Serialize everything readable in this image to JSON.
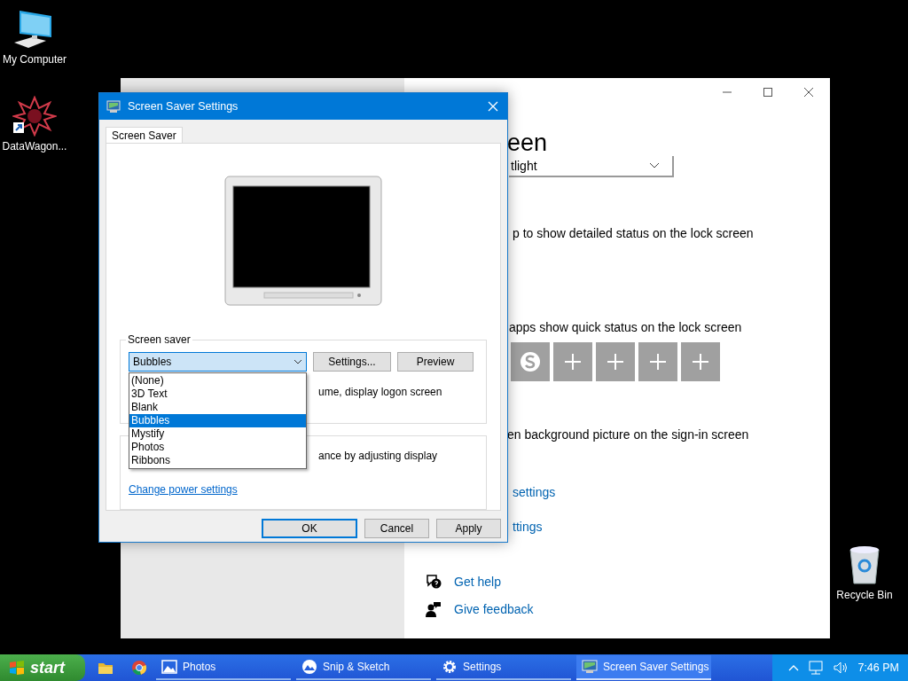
{
  "desktop_icons": [
    {
      "kind": "computer",
      "label": "My Computer"
    },
    {
      "kind": "shortcut",
      "label": "DataWagon..."
    },
    {
      "kind": "recycle",
      "label": "Recycle Bin"
    }
  ],
  "settings_window": {
    "rows": [
      {
        "kind": "heading",
        "text": "een"
      },
      {
        "kind": "dropdown",
        "value": "tlight"
      },
      {
        "kind": "text",
        "text": "p to show detailed status on the lock screen"
      },
      {
        "kind": "text",
        "text": "apps show quick status on the lock screen"
      },
      {
        "kind": "tiles",
        "tiles": [
          {
            "kind": "skype"
          },
          {
            "kind": "add"
          },
          {
            "kind": "add"
          },
          {
            "kind": "add"
          },
          {
            "kind": "add"
          }
        ]
      },
      {
        "kind": "text",
        "text": "en background picture on the sign-in screen"
      },
      {
        "kind": "link",
        "text": "settings"
      },
      {
        "kind": "link",
        "text": "ttings"
      },
      {
        "kind": "help",
        "text": "Get help"
      },
      {
        "kind": "feedback",
        "text": "Give feedback"
      }
    ]
  },
  "dialog": {
    "title": "Screen Saver Settings",
    "tabs": [
      {
        "label": "Screen Saver",
        "selected": true
      }
    ],
    "screen_saver_group": {
      "label": "Screen saver",
      "value": "Bubbles",
      "buttons": [
        "Settings...",
        "Preview"
      ],
      "resume_text": "ume, display logon screen",
      "options": [
        {
          "label": "(None)",
          "selected": false
        },
        {
          "label": "3D Text",
          "selected": false
        },
        {
          "label": "Blank",
          "selected": false
        },
        {
          "label": "Bubbles",
          "selected": true
        },
        {
          "label": "Mystify",
          "selected": false
        },
        {
          "label": "Photos",
          "selected": false
        },
        {
          "label": "Ribbons",
          "selected": false
        }
      ]
    },
    "power_group": {
      "text": "ance by adjusting display",
      "link": "Change power settings"
    },
    "buttons": [
      {
        "label": "OK",
        "default": true
      },
      {
        "label": "Cancel",
        "default": false
      },
      {
        "label": "Apply",
        "default": false
      }
    ]
  },
  "taskbar": {
    "start": "start",
    "pinned": [
      {
        "kind": "folder"
      },
      {
        "kind": "chrome"
      }
    ],
    "tasks": [
      {
        "kind": "photos",
        "label": "Photos",
        "active": false
      },
      {
        "kind": "snip",
        "label": "Snip & Sketch",
        "active": false
      },
      {
        "kind": "settings",
        "label": "Settings",
        "active": false
      },
      {
        "kind": "screensaver",
        "label": "Screen Saver Settings",
        "active": true
      }
    ],
    "clock": "7:46 PM"
  }
}
